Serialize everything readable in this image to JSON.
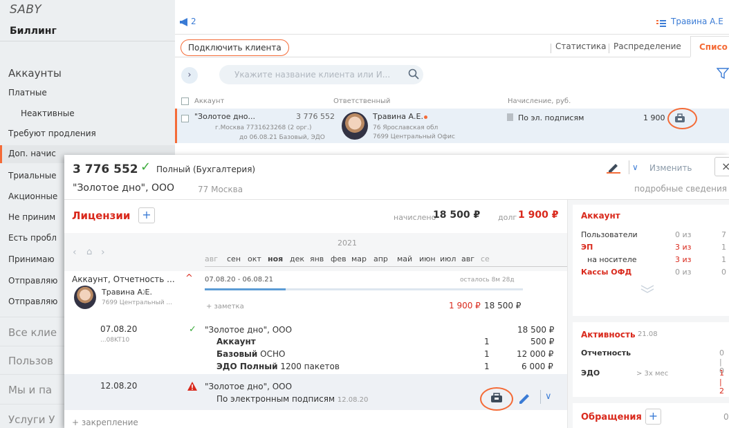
{
  "app": {
    "logo": "SABY",
    "billing": "Биллинг"
  },
  "sidebar": {
    "section_title": "Аккаунты",
    "items": [
      "Платные",
      "Неактивные",
      "Требуют продления",
      "Доп. начис",
      "Триальные",
      "Акционные",
      "Не приним",
      "Есть пробл",
      "Принимаю",
      "Отправляю",
      "Отправляю"
    ],
    "bottom": [
      "Все клие",
      "Пользов",
      "Мы и па",
      "Услуги У"
    ]
  },
  "topbar": {
    "notif_count": "2",
    "user": "Травина А.Е"
  },
  "toolbar": {
    "connect_button": "Подключить клиента",
    "tabs": [
      "Статистика",
      "Распределение"
    ],
    "active_tab": "Списо"
  },
  "search": {
    "placeholder": "Укажите название клиента или И..."
  },
  "table": {
    "headers": [
      "Аккаунт",
      "Ответственный",
      "Начисление, руб."
    ],
    "row": {
      "name": "\"Золотое дно...",
      "amount": "3 776 552",
      "line2": "г.Москва 7731623268  (2 орг.)",
      "line3": "до 06.08.21 Базовый, ЭДО",
      "resp_name": "Травина А.Е.",
      "resp_line2": "76 Ярославская обл",
      "resp_line3": "7699 Центральный Офис",
      "charge": "По эл. подписям",
      "charge_amount": "1 900"
    }
  },
  "panel": {
    "amount": "3 776 552",
    "plan": "Полный (Бухгалтерия)",
    "client": "\"Золотое дно\", ООО",
    "region": "77 Москва",
    "edit": "Изменить",
    "details": "подробные сведения"
  },
  "licenses": {
    "title": "Лицензии",
    "accrued_label": "начислено",
    "accrued": "18 500 ₽",
    "debt_label": "долг",
    "debt": "1 900 ₽",
    "year": "2021",
    "months": [
      "авг",
      "сен",
      "окт",
      "ноя",
      "дек",
      "янв",
      "фев",
      "мар",
      "апр",
      "май",
      "июн",
      "июл",
      "авг",
      "се"
    ],
    "item_title": "Аккаунт, Отчетность ...",
    "item_period": "07.08.20 - 06.08.21",
    "item_left": "осталось 8м 28д",
    "item_person": "Травина А.Е.",
    "item_office": "7699 Центральный ...",
    "note": "+ заметка",
    "item_debt": "1 900 ₽",
    "item_total": "18 500 ₽",
    "op1": {
      "date": "07.08.20",
      "code": "...08KT10",
      "client": "\"Золотое дно\", ООО",
      "total": "18 500 ₽",
      "lines": [
        {
          "bold": "Аккаунт",
          "rest": "",
          "qty": "1",
          "sum": "500 ₽"
        },
        {
          "bold": "Базовый",
          "rest": " ОСНО",
          "qty": "1",
          "sum": "12 000 ₽"
        },
        {
          "bold": "ЭДО Полный",
          "rest": " 1200 пакетов",
          "qty": "1",
          "sum": "6 000 ₽"
        }
      ]
    },
    "op2": {
      "date": "12.08.20",
      "client": "\"Золотое дно\", ООО",
      "desc": "По электронным подписям",
      "desc_date": "12.08.20"
    },
    "pin": "+ закрепление"
  },
  "account_card": {
    "title": "Аккаунт",
    "rows": [
      {
        "label": "Пользователи",
        "val": "0 из",
        "rest": "7"
      },
      {
        "label": "ЭП",
        "val": "3 из",
        "rest": "1"
      },
      {
        "label": "на носителе",
        "val": "3 из",
        "rest": "1"
      },
      {
        "label": "Кассы ОФД",
        "val": "0 из",
        "rest": "0"
      }
    ]
  },
  "activity_card": {
    "title": "Активность",
    "date": "21.08",
    "rows": [
      {
        "label": "Отчетность",
        "extra": "",
        "val": "0 | 0"
      },
      {
        "label": "ЭДО",
        "extra": "> 3х мес",
        "val": "1 | 2"
      }
    ]
  },
  "requests_card": {
    "title": "Обращения",
    "val": "0"
  },
  "colors": {
    "accent": "#f46b37",
    "red": "#d9291c",
    "link": "#3a7bd5"
  }
}
